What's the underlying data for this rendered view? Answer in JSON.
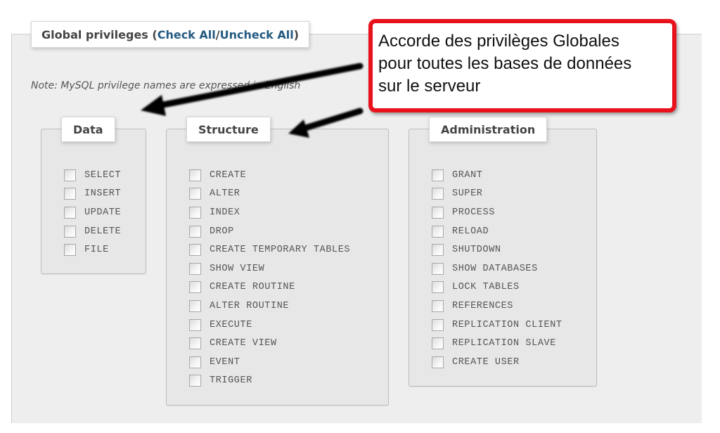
{
  "global_privileges": {
    "title_prefix": "Global privileges (",
    "check_all": "Check All",
    "separator": " / ",
    "uncheck_all": "Uncheck All",
    "title_suffix": ")",
    "note": "Note: MySQL privilege names are expressed in English"
  },
  "groups": [
    {
      "legend": "Data",
      "items": [
        {
          "label": "SELECT",
          "checked": false
        },
        {
          "label": "INSERT",
          "checked": false
        },
        {
          "label": "UPDATE",
          "checked": false
        },
        {
          "label": "DELETE",
          "checked": false
        },
        {
          "label": "FILE",
          "checked": false
        }
      ]
    },
    {
      "legend": "Structure",
      "items": [
        {
          "label": "CREATE",
          "checked": false
        },
        {
          "label": "ALTER",
          "checked": false
        },
        {
          "label": "INDEX",
          "checked": false
        },
        {
          "label": "DROP",
          "checked": false
        },
        {
          "label": "CREATE TEMPORARY TABLES",
          "checked": false
        },
        {
          "label": "SHOW VIEW",
          "checked": false
        },
        {
          "label": "CREATE ROUTINE",
          "checked": false
        },
        {
          "label": "ALTER ROUTINE",
          "checked": false
        },
        {
          "label": "EXECUTE",
          "checked": false
        },
        {
          "label": "CREATE VIEW",
          "checked": false
        },
        {
          "label": "EVENT",
          "checked": false
        },
        {
          "label": "TRIGGER",
          "checked": false
        }
      ]
    },
    {
      "legend": "Administration",
      "items": [
        {
          "label": "GRANT",
          "checked": false
        },
        {
          "label": "SUPER",
          "checked": false
        },
        {
          "label": "PROCESS",
          "checked": false
        },
        {
          "label": "RELOAD",
          "checked": false
        },
        {
          "label": "SHUTDOWN",
          "checked": false
        },
        {
          "label": "SHOW DATABASES",
          "checked": false
        },
        {
          "label": "LOCK TABLES",
          "checked": false
        },
        {
          "label": "REFERENCES",
          "checked": false
        },
        {
          "label": "REPLICATION CLIENT",
          "checked": false
        },
        {
          "label": "REPLICATION SLAVE",
          "checked": false
        },
        {
          "label": "CREATE USER",
          "checked": false
        }
      ]
    }
  ],
  "annotation": {
    "lines": [
      "Accorde des privilèges Globales",
      "pour toutes les bases de données",
      "sur le serveur"
    ],
    "border_color": "#e8121c",
    "arrow_color": "#000000"
  },
  "colors": {
    "link": "#235a81",
    "panel_bg": "#eeeeee",
    "group_bg": "#e7e7e7"
  }
}
